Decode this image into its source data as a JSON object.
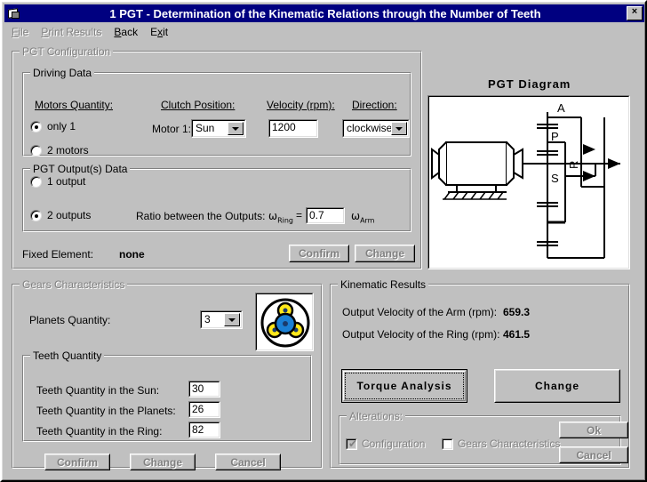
{
  "window": {
    "title": "1 PGT - Determination of the Kinematic Relations through the Number of Teeth",
    "icon": "application-icon",
    "close_label": "×"
  },
  "menu": {
    "items": [
      {
        "label": "File",
        "accel": "F",
        "enabled": false
      },
      {
        "label": "Print Results",
        "accel": "P",
        "enabled": false
      },
      {
        "label": "Back",
        "accel": "B",
        "enabled": true
      },
      {
        "label": "Exit",
        "accel": "x",
        "enabled": true
      }
    ]
  },
  "pgt_configuration": {
    "label": "PGT Configuration",
    "enabled": false,
    "driving_data": {
      "label": "Driving Data",
      "motors_quantity_label": "Motors Quantity:",
      "clutch_position_label": "Clutch Position:",
      "velocity_label": "Velocity (rpm):",
      "direction_label": "Direction:",
      "motor1_label": "Motor 1:",
      "radio_only_1": "only 1",
      "radio_2_motors": "2 motors",
      "selected_motors": "only 1",
      "clutch_position_value": "Sun",
      "velocity_value": "1200",
      "direction_value": "clockwise"
    },
    "output_data": {
      "label": "PGT Output(s) Data",
      "radio_1_output": "1 output",
      "radio_2_outputs": "2 outputs",
      "selected_outputs": "2 outputs",
      "ratio_label": "Ratio between the Outputs:",
      "omega_ring": "ω",
      "omega_ring_sub": "Ring",
      "equals": "=",
      "ratio_value": "0.7",
      "omega_arm": "ω",
      "omega_arm_sub": "Arm"
    },
    "fixed_element_label": "Fixed Element:",
    "fixed_element_value": "none",
    "confirm_label": "Confirm",
    "confirm_enabled": false,
    "change_label": "Change",
    "change_enabled": false
  },
  "diagram": {
    "title": "PGT Diagram",
    "labels": {
      "arm": "A",
      "planet": "P",
      "sun": "S",
      "ring": "R"
    }
  },
  "gears_characteristics": {
    "label": "Gears Characteristics",
    "enabled": false,
    "planets_quantity_label": "Planets Quantity:",
    "planets_quantity_value": "3",
    "gear_icon": "planetary-gear-icon",
    "gear_colors": {
      "sun": "#1a7fd4",
      "planet": "#ffe81a",
      "ring": "#000000",
      "hub": "#1a3a6b"
    },
    "teeth_quantity": {
      "label": "Teeth Quantity",
      "sun_label": "Teeth Quantity in the Sun:",
      "sun_value": "30",
      "planets_label": "Teeth Quantity in the Planets:",
      "planets_value": "26",
      "ring_label": "Teeth Quantity in the Ring:",
      "ring_value": "82"
    },
    "confirm_label": "Confirm",
    "confirm_enabled": false,
    "change_label": "Change",
    "change_enabled": false,
    "cancel_label": "Cancel",
    "cancel_enabled": false
  },
  "kinematic_results": {
    "label": "Kinematic Results",
    "arm_label": "Output Velocity of the Arm (rpm):",
    "arm_value": "659.3",
    "ring_label": "Output Velocity of the Ring (rpm):",
    "ring_value": "461.5",
    "torque_analysis_label": "Torque Analysis",
    "torque_analysis_focused": true,
    "change_label": "Change",
    "alterations": {
      "label": "Alterations:",
      "enabled": false,
      "configuration_label": "Configuration",
      "configuration_checked": true,
      "gears_characteristics_label": "Gears Characteristics",
      "gears_characteristics_checked": false,
      "ok_label": "Ok",
      "ok_enabled": false,
      "cancel_label": "Cancel",
      "cancel_enabled": false
    }
  }
}
